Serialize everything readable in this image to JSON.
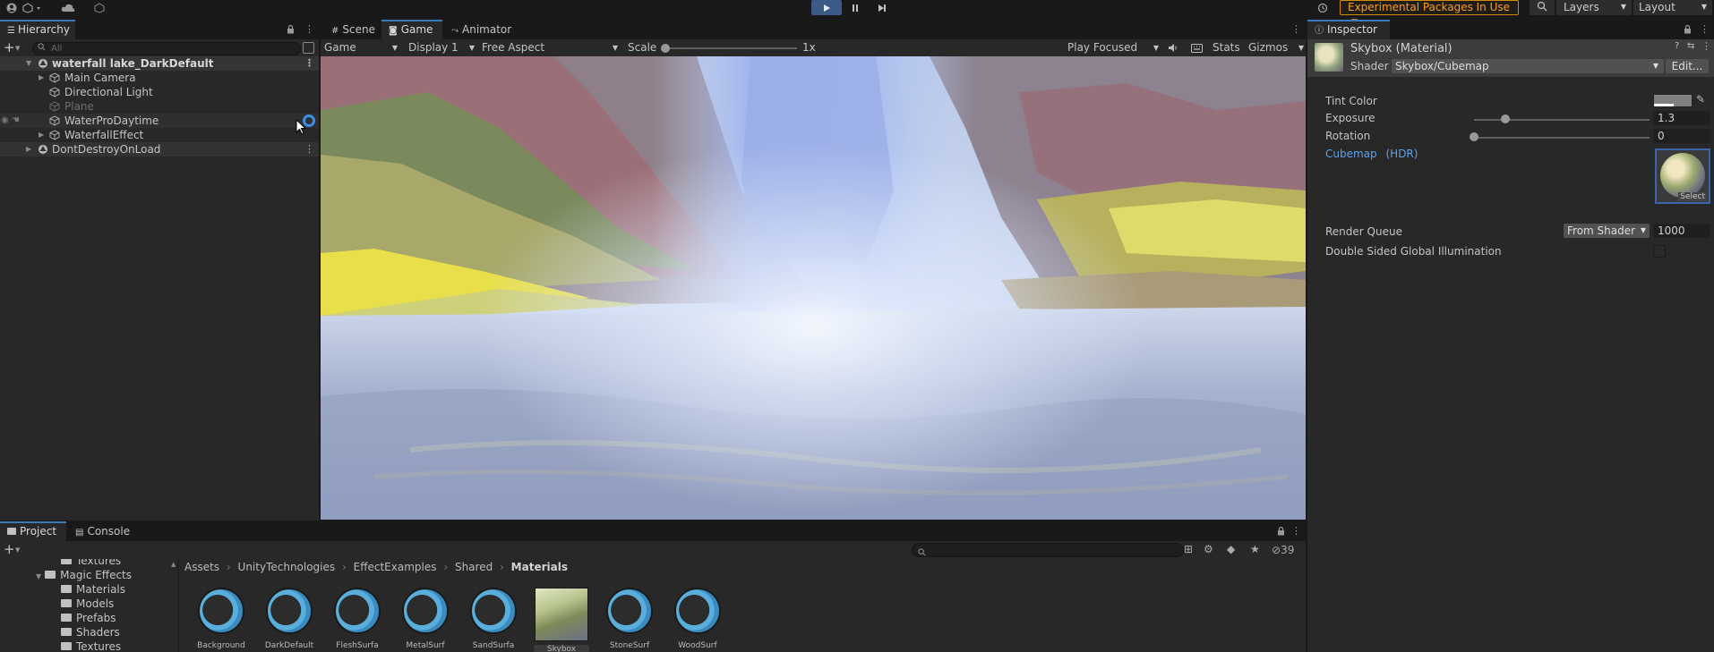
{
  "toolbar": {
    "experimental_label": "Experimental Packages In Use",
    "layers_label": "Layers",
    "layout_label": "Layout"
  },
  "hierarchy": {
    "tab_label": "Hierarchy",
    "search_placeholder": "All",
    "rows": [
      {
        "label": "waterfall lake_DarkDefault"
      },
      {
        "label": "Main Camera"
      },
      {
        "label": "Directional Light"
      },
      {
        "label": "Plane"
      },
      {
        "label": "WaterProDaytime"
      },
      {
        "label": "WaterfallEffect"
      },
      {
        "label": "DontDestroyOnLoad"
      }
    ]
  },
  "game": {
    "tabs": [
      {
        "label": "Scene"
      },
      {
        "label": "Game"
      },
      {
        "label": "Animator"
      }
    ],
    "view_dropdown": "Game",
    "display_dropdown": "Display 1",
    "aspect_dropdown": "Free Aspect",
    "scale_label": "Scale",
    "scale_value": "1x",
    "play_mode_dropdown": "Play Focused",
    "stats_label": "Stats",
    "gizmos_label": "Gizmos"
  },
  "inspector": {
    "tab_label": "Inspector",
    "material_title": "Skybox (Material)",
    "shader_label": "Shader",
    "shader_value": "Skybox/Cubemap",
    "edit_button": "Edit...",
    "tint_label": "Tint Color",
    "exposure_label": "Exposure",
    "exposure_value": "1.3",
    "exposure_fraction": 0.18,
    "rotation_label": "Rotation",
    "rotation_value": "0",
    "rotation_fraction": 0.0,
    "cubemap_label": "Cubemap",
    "cubemap_hdr": "(HDR)",
    "select_label": "Select",
    "render_queue_label": "Render Queue",
    "render_queue_dropdown": "From Shader",
    "render_queue_value": "1000",
    "double_sided_label": "Double Sided Global Illumination",
    "double_sided_checked": false
  },
  "project": {
    "tabs": [
      {
        "label": "Project"
      },
      {
        "label": "Console"
      }
    ],
    "hidden_count": "39",
    "tree": [
      {
        "label": "Textures"
      },
      {
        "label": "Magic Effects"
      },
      {
        "label": "Materials"
      },
      {
        "label": "Models"
      },
      {
        "label": "Prefabs"
      },
      {
        "label": "Shaders"
      },
      {
        "label": "Textures"
      }
    ],
    "breadcrumb": [
      "Assets",
      "UnityTechnologies",
      "EffectExamples",
      "Shared",
      "Materials"
    ],
    "assets": [
      {
        "label": "Background",
        "kind": "material"
      },
      {
        "label": "DarkDefault",
        "kind": "material"
      },
      {
        "label": "FleshSurfa",
        "kind": "material"
      },
      {
        "label": "MetalSurf",
        "kind": "material"
      },
      {
        "label": "SandSurfa",
        "kind": "material"
      },
      {
        "label": "Skybox",
        "kind": "skybox"
      },
      {
        "label": "StoneSurf",
        "kind": "material"
      },
      {
        "label": "WoodSurf",
        "kind": "material"
      }
    ]
  }
}
